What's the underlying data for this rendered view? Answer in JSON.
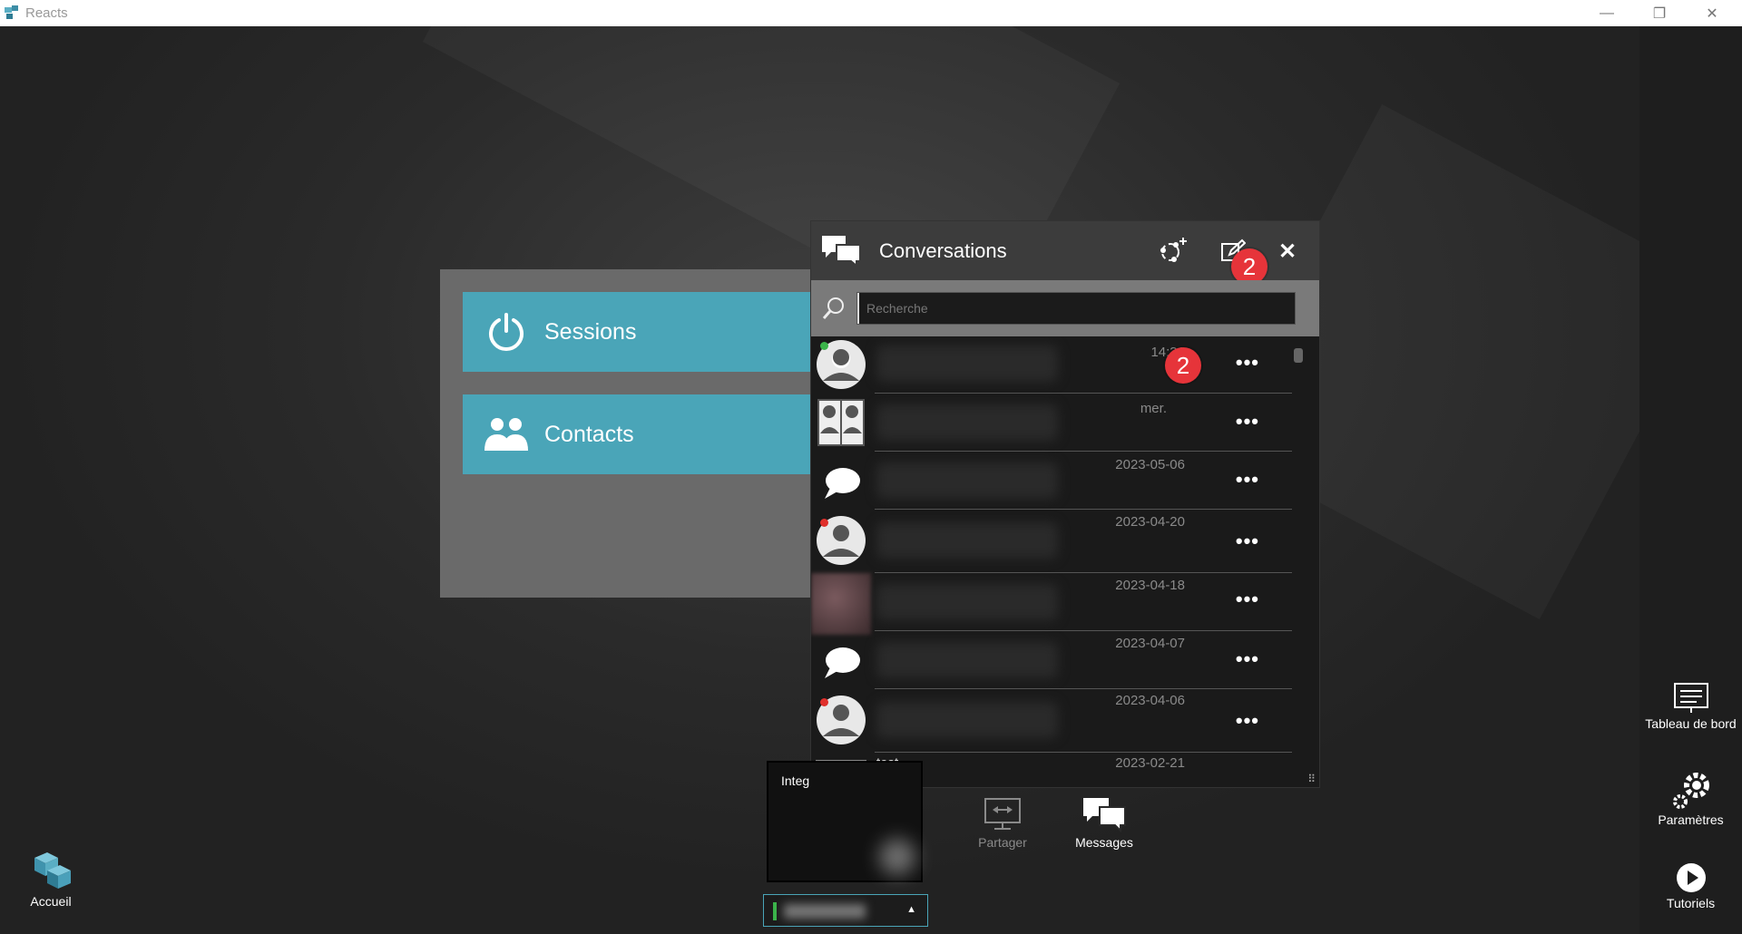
{
  "window": {
    "title": "Reacts"
  },
  "home": {
    "sessions_label": "Sessions",
    "contacts_label": "Contacts"
  },
  "conversations": {
    "title": "Conversations",
    "search_placeholder": "Recherche",
    "header_badge": "2",
    "items": [
      {
        "time": "14:31",
        "badge": "2",
        "status": "online"
      },
      {
        "time": "mer.",
        "badge": "",
        "status": ""
      },
      {
        "time": "2023-05-06",
        "badge": "",
        "status": ""
      },
      {
        "time": "2023-04-20",
        "badge": "",
        "status": "busy"
      },
      {
        "time": "2023-04-18",
        "badge": "",
        "status": ""
      },
      {
        "time": "2023-04-07",
        "badge": "",
        "status": ""
      },
      {
        "time": "2023-04-06",
        "badge": "",
        "status": "busy"
      },
      {
        "name": "test",
        "time": "2023-02-21",
        "badge": "",
        "status": ""
      }
    ],
    "more_label": "•••"
  },
  "bottom": {
    "preview_label": "Integ",
    "share_label": "Partager",
    "messages_label": "Messages"
  },
  "sidebar": {
    "dashboard_label": "Tableau de bord",
    "settings_label": "Paramètres",
    "tutorials_label": "Tutoriels"
  },
  "home_button": {
    "label": "Accueil"
  },
  "colors": {
    "accent": "#4aa5b8",
    "badge": "#e6343a",
    "online": "#3bb44a",
    "busy": "#e0302c"
  }
}
